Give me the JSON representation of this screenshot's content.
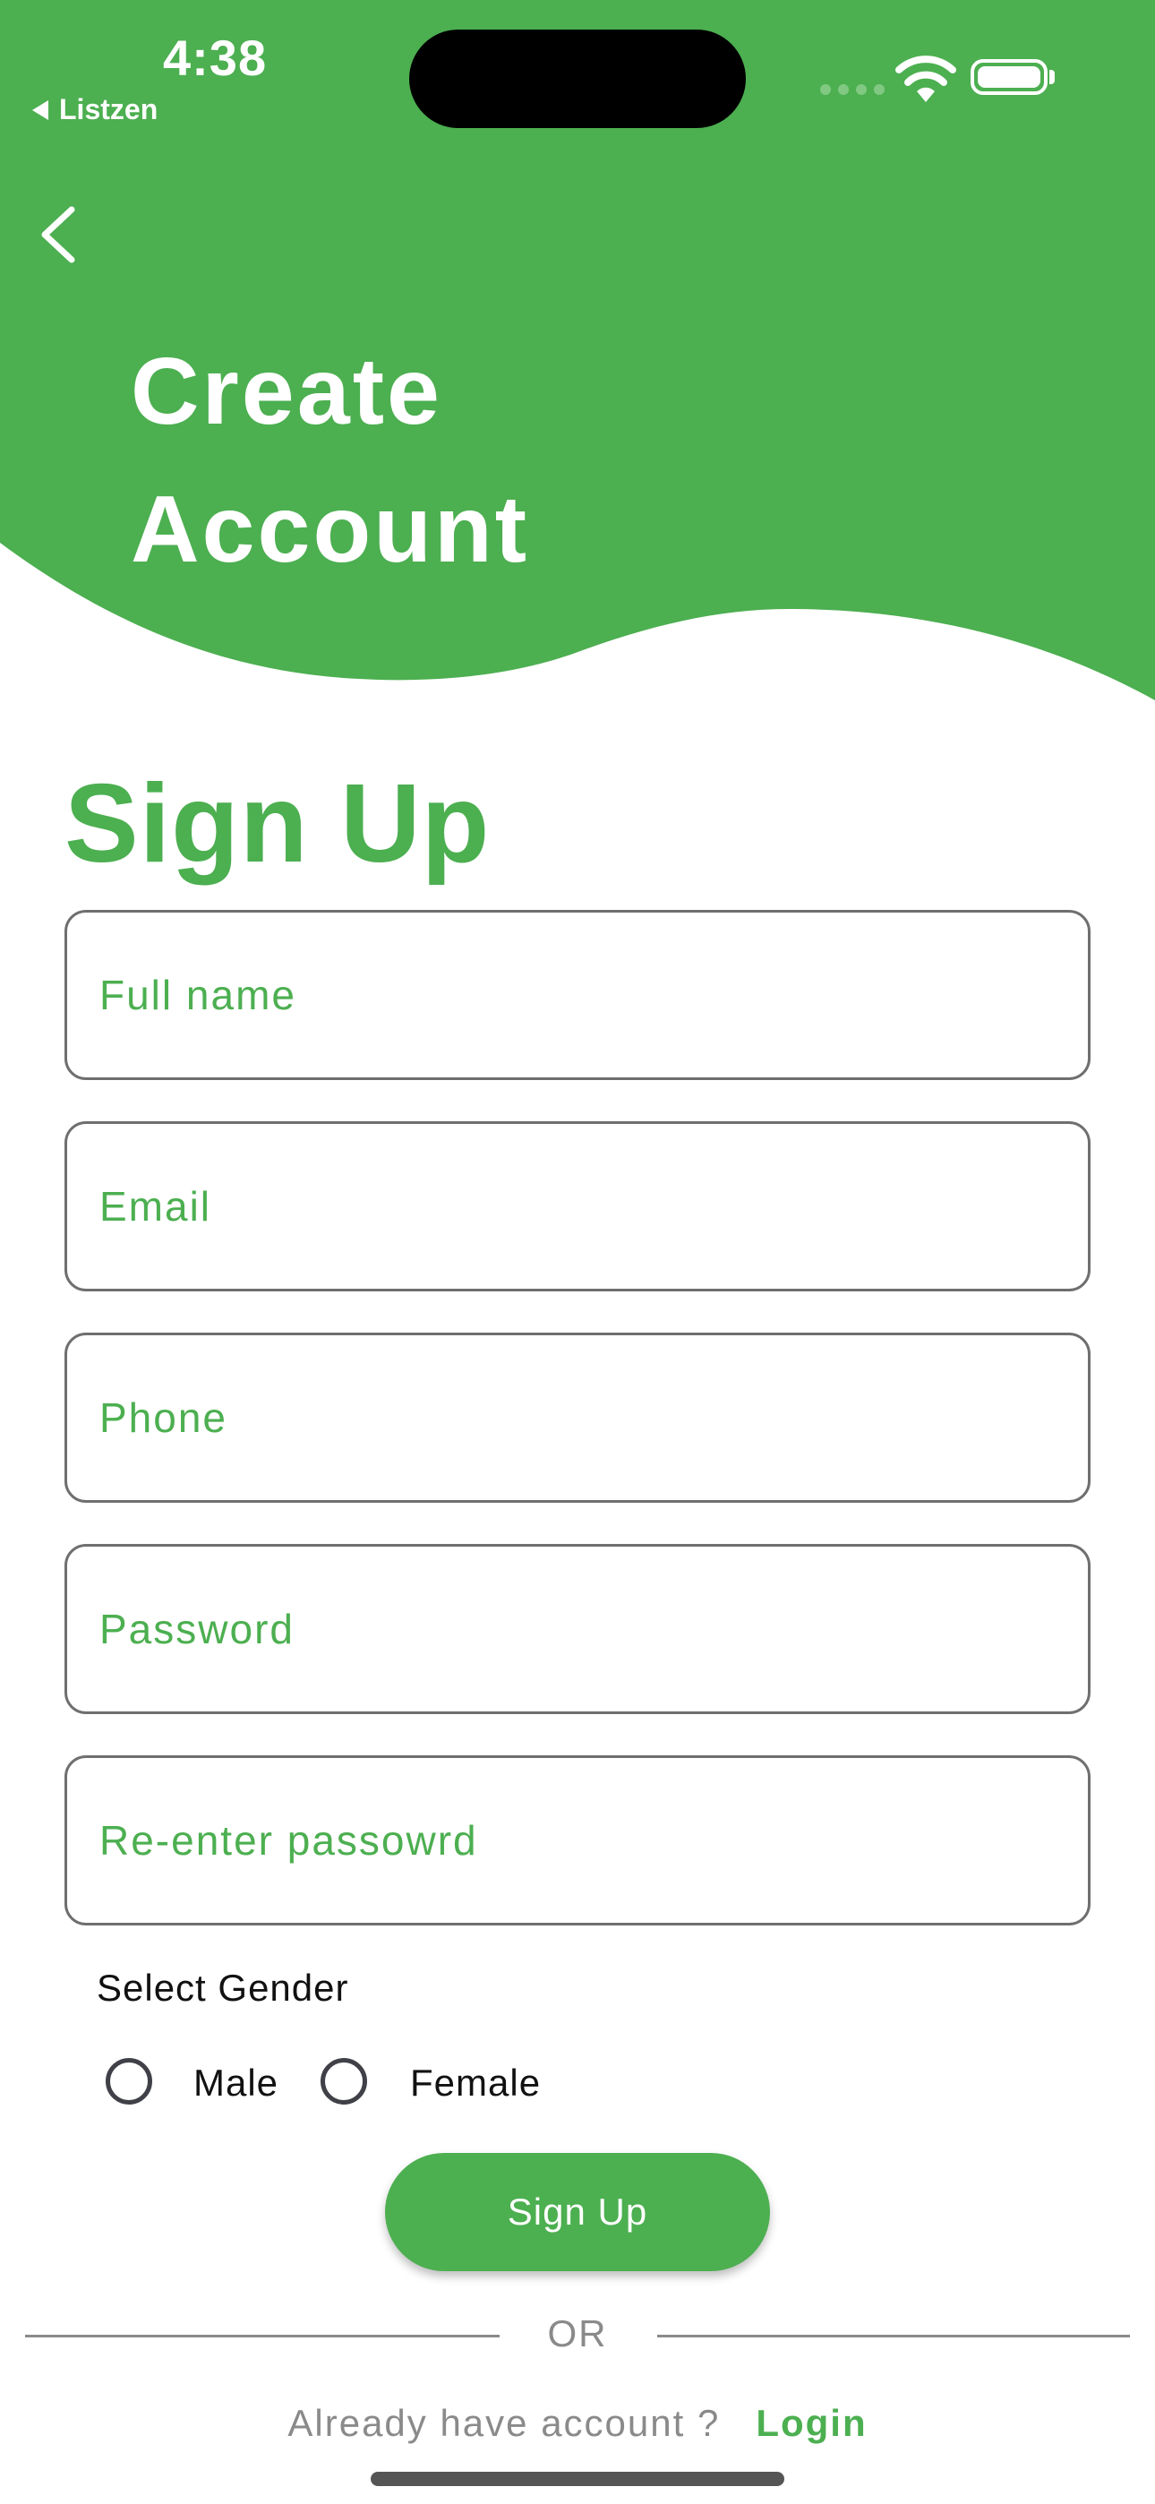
{
  "status_bar": {
    "time": "4:38",
    "back_app": "Listzen"
  },
  "header": {
    "title_line1": "Create",
    "title_line2": "Account"
  },
  "colors": {
    "brand_green": "#4caf50",
    "text_gray": "#8a8a8a"
  },
  "form": {
    "heading": "Sign Up",
    "fields": [
      {
        "placeholder": "Full name",
        "value": ""
      },
      {
        "placeholder": "Email",
        "value": ""
      },
      {
        "placeholder": "Phone",
        "value": ""
      },
      {
        "placeholder": "Password",
        "value": ""
      },
      {
        "placeholder": "Re-enter passowrd",
        "value": ""
      }
    ],
    "gender": {
      "label": "Select Gender",
      "options": [
        "Male",
        "Female"
      ]
    },
    "submit_label": "Sign Up"
  },
  "or_text": "OR",
  "footer": {
    "question": "Already have account ?",
    "login_label": "Login"
  },
  "icons": [
    "chevron-left-icon",
    "wifi-icon",
    "battery-icon"
  ]
}
